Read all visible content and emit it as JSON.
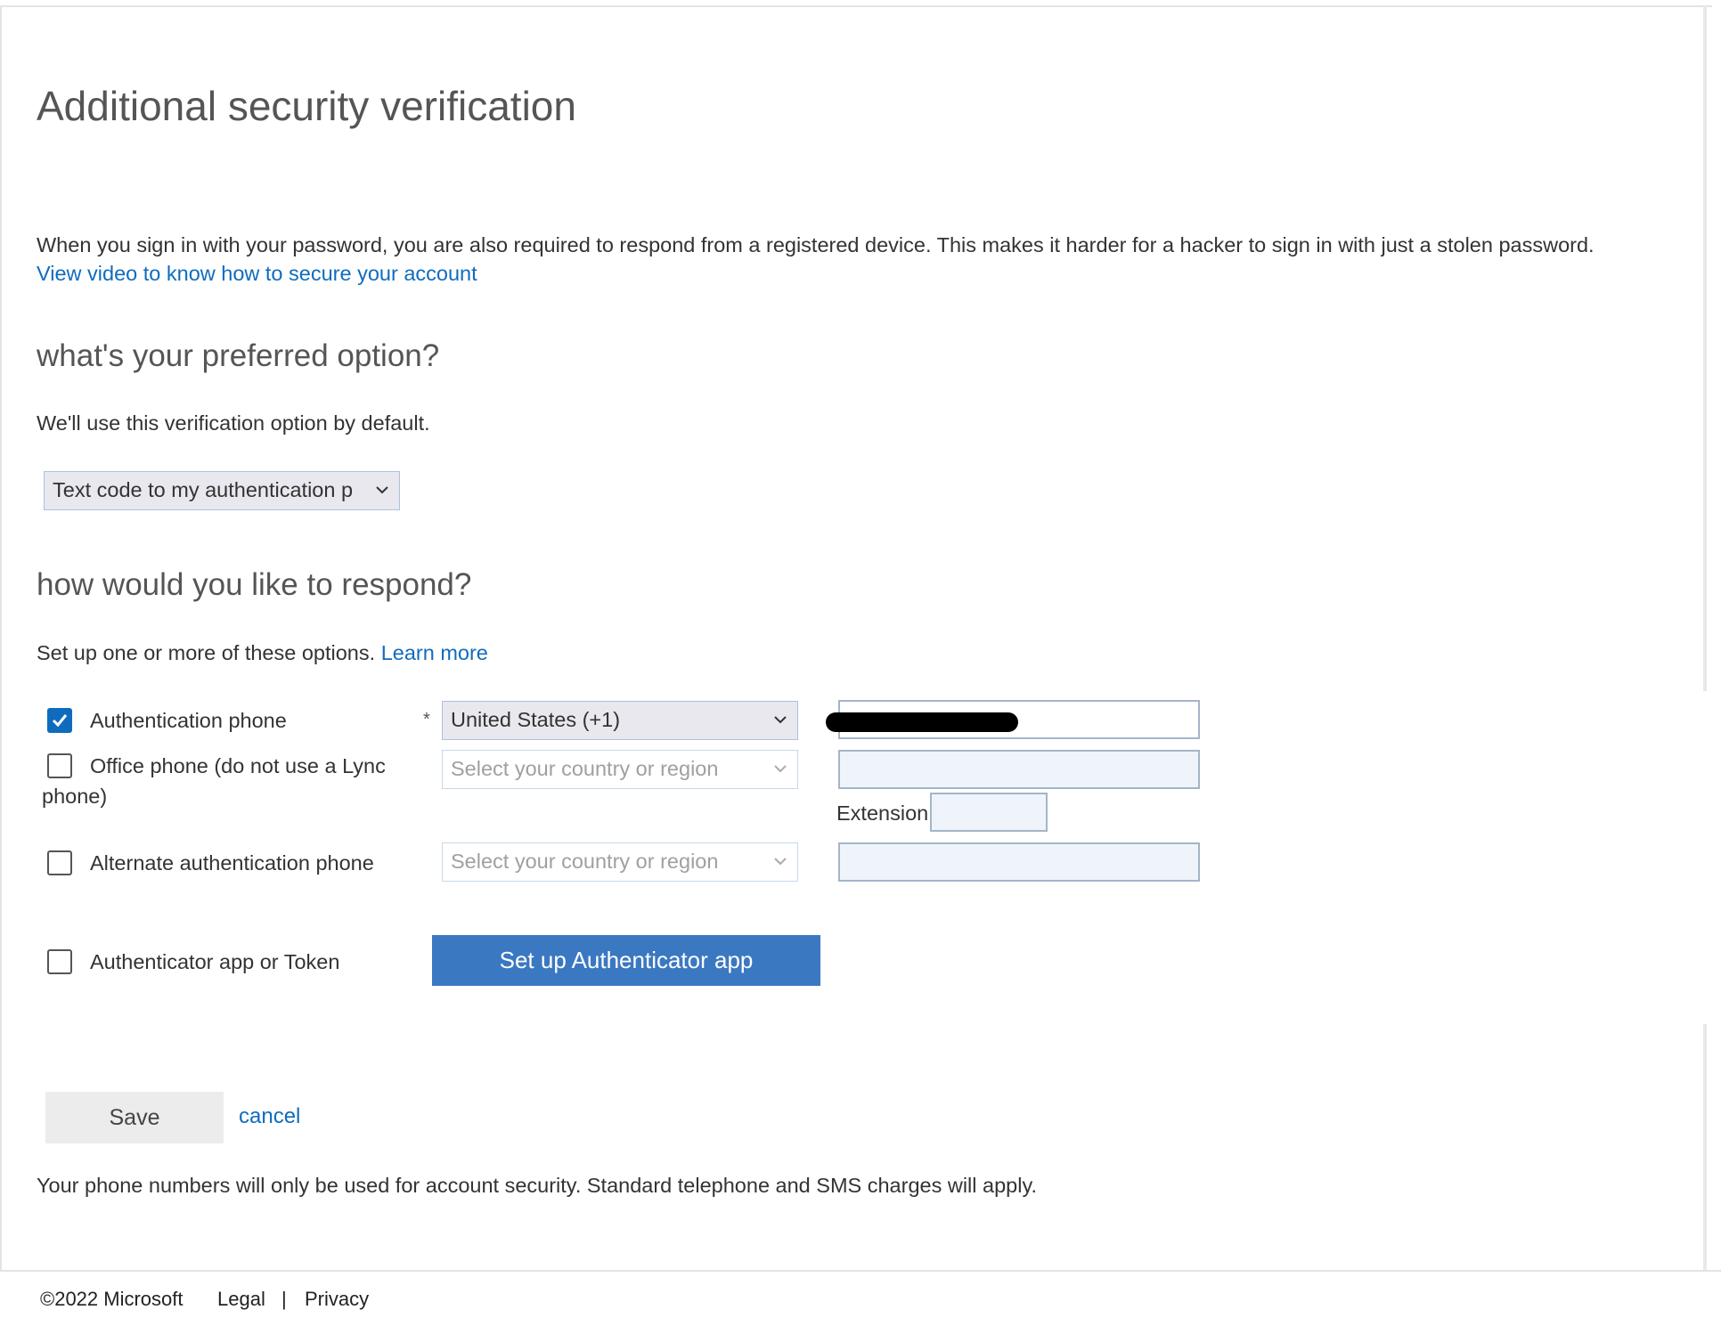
{
  "page": {
    "title": "Additional security verification",
    "intro": "When you sign in with your password, you are also required to respond from a registered device. This makes it harder for a hacker to sign in with just a stolen password.",
    "video_link": "View video to know how to secure your account"
  },
  "preferred": {
    "heading": "what's your preferred option?",
    "description": "We'll use this verification option by default.",
    "selected": "Text code to my authentication p"
  },
  "respond": {
    "heading": "how would you like to respond?",
    "description": "Set up one or more of these options.",
    "learn_more": "Learn more",
    "required_mark": "*",
    "options": [
      {
        "label": "Authentication phone",
        "checked": true,
        "country": "United States (+1)",
        "phone_value": "[redacted]"
      },
      {
        "label_line1": "Office phone (do not use a Lync",
        "label_line2": "phone)",
        "checked": false,
        "country_placeholder": "Select your country or region",
        "extension_label": "Extension"
      },
      {
        "label": "Alternate authentication phone",
        "checked": false,
        "country_placeholder": "Select your country or region"
      },
      {
        "label": "Authenticator app or Token",
        "checked": false,
        "button": "Set up Authenticator app"
      }
    ]
  },
  "actions": {
    "save": "Save",
    "cancel": "cancel"
  },
  "disclaimer": "Your phone numbers will only be used for account security. Standard telephone and SMS charges will apply.",
  "footer": {
    "copyright": "©2022 Microsoft",
    "legal": "Legal",
    "separator": "|",
    "privacy": "Privacy"
  },
  "colors": {
    "link": "#0f6cbd",
    "primary_button": "#3b78c2",
    "checkbox_checked": "#0f6cbd"
  },
  "icons": {
    "dropdown": "chevron-down-icon",
    "check": "checkmark-icon"
  }
}
